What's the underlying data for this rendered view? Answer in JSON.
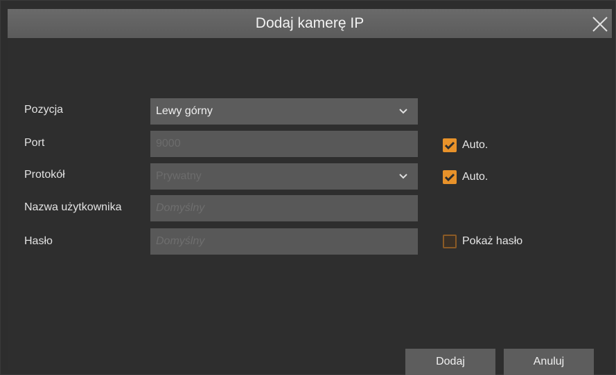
{
  "dialog": {
    "title": "Dodaj kamerę IP",
    "close_icon": "close-icon"
  },
  "form": {
    "position": {
      "label": "Pozycja",
      "value": "Lewy górny"
    },
    "port": {
      "label": "Port",
      "value": "9000",
      "auto_label": "Auto.",
      "auto_checked": true
    },
    "protocol": {
      "label": "Protokół",
      "value": "Prywatny",
      "auto_label": "Auto.",
      "auto_checked": true
    },
    "username": {
      "label": "Nazwa użytkownika",
      "placeholder": "Domyślny"
    },
    "password": {
      "label": "Hasło",
      "placeholder": "Domyślny",
      "show_label": "Pokaż hasło",
      "show_checked": false
    }
  },
  "buttons": {
    "add": "Dodaj",
    "cancel": "Anuluj"
  },
  "colors": {
    "accent": "#e8922a"
  }
}
